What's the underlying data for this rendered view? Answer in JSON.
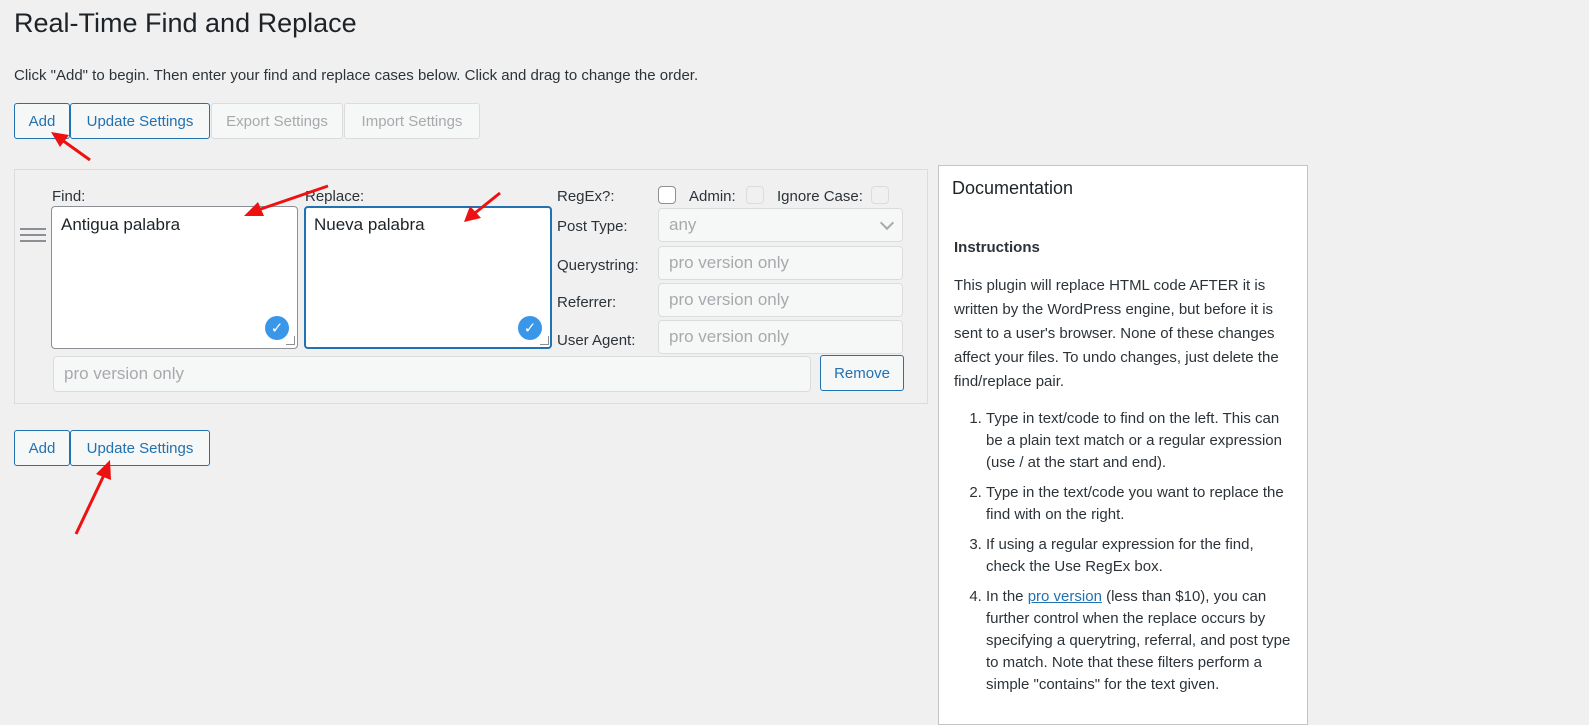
{
  "page": {
    "title": "Real-Time Find and Replace",
    "intro": "Click \"Add\" to begin. Then enter your find and replace cases below. Click and drag to change the order."
  },
  "toolbar_top": {
    "add": "Add",
    "update": "Update Settings",
    "export": "Export Settings",
    "import": "Import Settings"
  },
  "case": {
    "find_label": "Find:",
    "find_value": "Antigua palabra",
    "replace_label": "Replace:",
    "replace_value": "Nueva palabra",
    "regex_label": "RegEx?:",
    "admin_label": "Admin:",
    "ignore_case_label": "Ignore Case:",
    "post_type_label": "Post Type:",
    "post_type_value": "any",
    "querystring_label": "Querystring:",
    "querystring_placeholder": "pro version only",
    "referrer_label": "Referrer:",
    "referrer_placeholder": "pro version only",
    "user_agent_label": "User Agent:",
    "user_agent_placeholder": "pro version only",
    "extra_placeholder": "pro version only",
    "remove": "Remove",
    "regex_checked": false,
    "admin_checked": false,
    "ignore_case_checked": false
  },
  "toolbar_bottom": {
    "add": "Add",
    "update": "Update Settings"
  },
  "documentation": {
    "title": "Documentation",
    "heading": "Instructions",
    "intro": "This plugin will replace HTML code AFTER it is written by the WordPress engine, but before it is sent to a user's browser. None of these changes affect your files. To undo changes, just delete the find/replace pair.",
    "step1": "Type in text/code to find on the left. This can be a plain text match or a regular expression (use / at the start and end).",
    "step2": "Type in the text/code you want to replace the find with on the right.",
    "step3": "If using a regular expression for the find, check the Use RegEx box.",
    "step4_prefix": "In the ",
    "step4_link": "pro version",
    "step4_suffix": " (less than $10), you can further control when the replace occurs by specifying a querytring, referral, and post type to match. Note that these filters perform a simple \"contains\" for the text given."
  },
  "colors": {
    "accent": "#2271b1",
    "annotation_arrow": "#ee1111",
    "check_badge": "#3a96e8"
  }
}
